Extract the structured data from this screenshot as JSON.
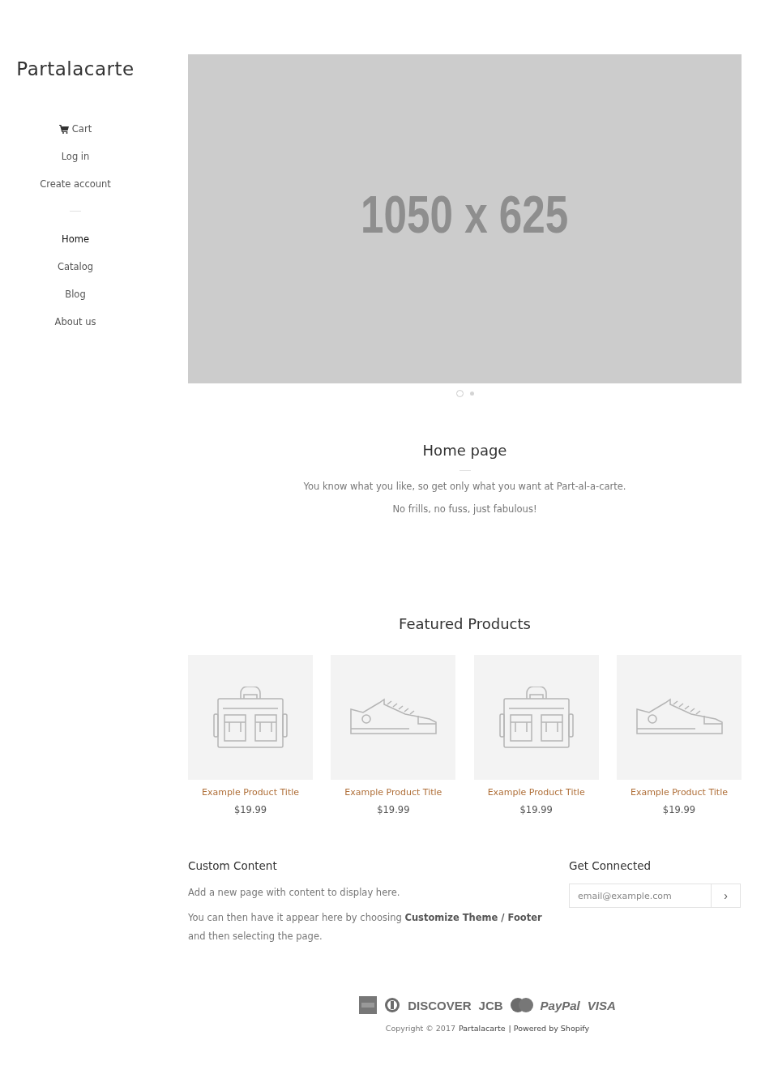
{
  "sidebar": {
    "logo": "Partalacarte",
    "account_links": [
      {
        "label": "Cart",
        "kind": "cart"
      },
      {
        "label": "Log in",
        "kind": "text"
      },
      {
        "label": "Create account",
        "kind": "text"
      }
    ],
    "nav": [
      {
        "label": "Home",
        "selected": true
      },
      {
        "label": "Catalog",
        "selected": false
      },
      {
        "label": "Blog",
        "selected": false
      },
      {
        "label": "About us",
        "selected": false
      }
    ]
  },
  "slideshow": {
    "placeholder_text": "1050 x 625",
    "dots": [
      {
        "selected": true
      },
      {
        "selected": false
      }
    ]
  },
  "intro": {
    "title": "Home page",
    "paragraphs": [
      "You know what you like, so get only what you want at Part-al-a-carte.",
      "No frills, no fuss, just fabulous!"
    ]
  },
  "featured": {
    "title": "Featured Products",
    "products": [
      {
        "kind": "bag",
        "title": "Example Product Title",
        "price": "$19.99"
      },
      {
        "kind": "shoe",
        "title": "Example Product Title",
        "price": "$19.99"
      },
      {
        "kind": "bag",
        "title": "Example Product Title",
        "price": "$19.99"
      },
      {
        "kind": "shoe",
        "title": "Example Product Title",
        "price": "$19.99"
      }
    ]
  },
  "footer": {
    "custom": {
      "title": "Custom Content",
      "paragraphs": [
        "Add a new page with content to display here.",
        "You can then have it appear here by choosing **Customize Theme / Footer** and then selecting the page."
      ]
    },
    "connect": {
      "title": "Get Connected",
      "placeholder": "email@example.com",
      "submit": "›"
    },
    "payments": [
      {
        "kind": "amex"
      },
      {
        "kind": "diners"
      },
      {
        "kind": "wordmark",
        "label": "DISCOVER"
      },
      {
        "kind": "wordmark",
        "label": "JCB"
      },
      {
        "kind": "mastercard"
      },
      {
        "kind": "italic",
        "label": "PayPal"
      },
      {
        "kind": "italic",
        "label": "VISA"
      }
    ],
    "copyright": "Copyright © 2017",
    "shop_link": "Partalacarte",
    "powered": "| Powered by Shopify"
  }
}
